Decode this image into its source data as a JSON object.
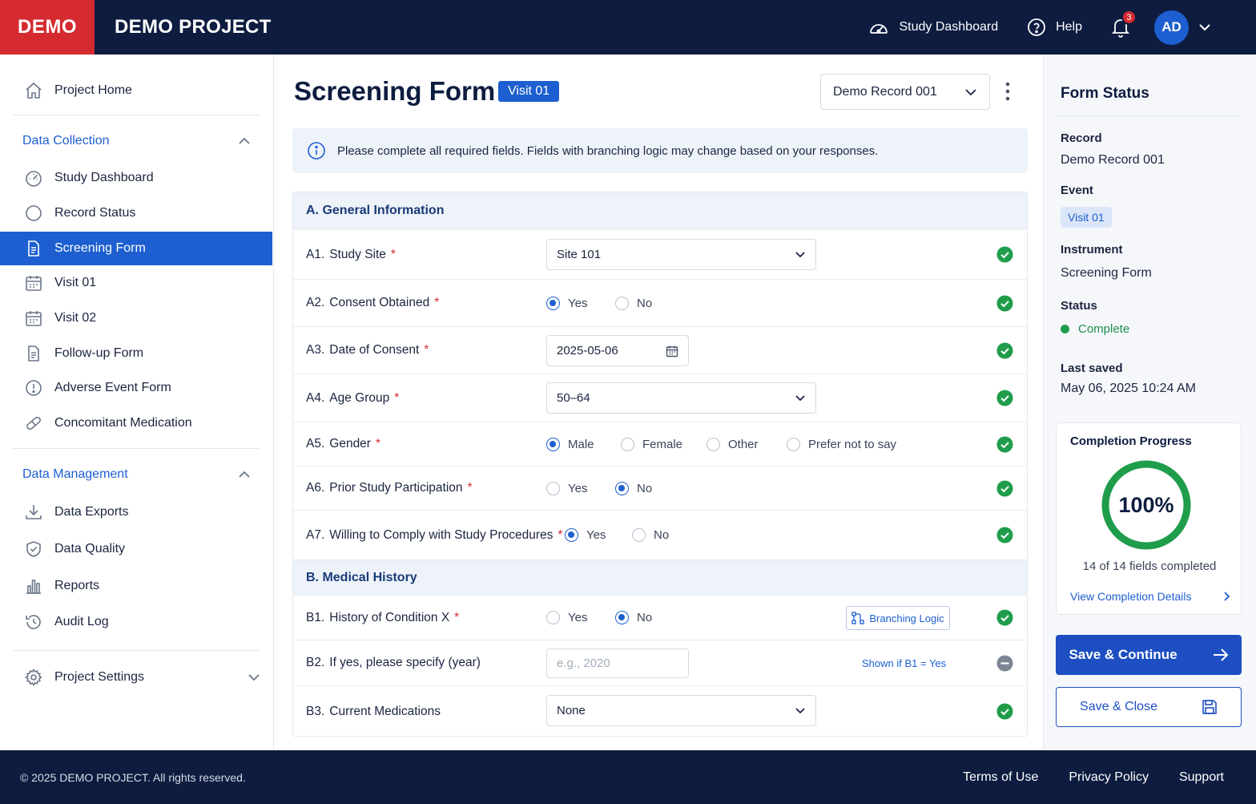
{
  "header": {
    "logo": "DEMO",
    "project_title": "DEMO PROJECT",
    "study_dashboard": "Study Dashboard",
    "help": "Help",
    "notifications_count": "3",
    "avatar_initials": "AD"
  },
  "sidebar": {
    "project_home": "Project Home",
    "data_collection": {
      "title": "Data Collection",
      "items": [
        "Study Dashboard",
        "Record Status",
        "Screening Form",
        "Visit 01",
        "Visit 02",
        "Follow-up Form",
        "Adverse Event Form",
        "Concomitant Medication"
      ]
    },
    "data_management": {
      "title": "Data Management",
      "items": [
        "Data Exports",
        "Data Quality",
        "Reports",
        "Audit Log"
      ]
    },
    "project_settings": "Project Settings"
  },
  "main": {
    "title": "Screening Form",
    "visit_tag": "Visit 01",
    "record_select": "Demo Record 001",
    "info": "Please complete all required fields. Fields with branching logic may change based on your responses.",
    "section_a": "A. General Information",
    "section_b": "B. Medical History",
    "fields": {
      "a1": {
        "num": "A1.",
        "label": "Study Site",
        "value": "Site 101"
      },
      "a2": {
        "num": "A2.",
        "label": "Consent Obtained",
        "opt1": "Yes",
        "opt2": "No"
      },
      "a3": {
        "num": "A3.",
        "label": "Date of Consent",
        "value": "2025-05-06"
      },
      "a4": {
        "num": "A4.",
        "label": "Age Group",
        "value": "50–64"
      },
      "a5": {
        "num": "A5.",
        "label": "Gender",
        "opt1": "Male",
        "opt2": "Female",
        "opt3": "Other",
        "opt4": "Prefer not to say"
      },
      "a6": {
        "num": "A6.",
        "label": "Prior Study Participation",
        "opt1": "Yes",
        "opt2": "No"
      },
      "a7": {
        "num": "A7.",
        "label": "Willing to Comply with Study Procedures",
        "opt1": "Yes",
        "opt2": "No"
      },
      "b1": {
        "num": "B1.",
        "label": "History of Condition X",
        "opt1": "Yes",
        "opt2": "No",
        "branching": "Branching Logic"
      },
      "b2": {
        "num": "B2.",
        "label": "If yes, please specify (year)",
        "placeholder": "e.g., 2020",
        "shown_if": "Shown if B1 = Yes"
      },
      "b3": {
        "num": "B3.",
        "label": "Current Medications",
        "value": "None"
      }
    },
    "required_mark": "*"
  },
  "status_panel": {
    "title": "Form Status",
    "record_label": "Record",
    "record_value": "Demo Record 001",
    "event_label": "Event",
    "event_value": "Visit 01",
    "instrument_label": "Instrument",
    "instrument_value": "Screening Form",
    "status_label": "Status",
    "status_value": "Complete",
    "last_saved_label": "Last saved",
    "last_saved_value": "May 06, 2025 10:24 AM",
    "progress_title": "Completion Progress",
    "progress_pct": "100%",
    "progress_fraction": 1.0,
    "progress_sub": "14 of 14 fields completed",
    "progress_link": "View Completion Details",
    "save_continue": "Save & Continue",
    "save_close": "Save & Close"
  },
  "footer": {
    "copyright": "© 2025 DEMO PROJECT. All rights reserved.",
    "terms": "Terms of Use",
    "privacy": "Privacy Policy",
    "support": "Support"
  },
  "colors": {
    "navy": "#0d1c3f",
    "brand_red": "#d52a30",
    "accent_blue": "#1d5fd0",
    "success_green": "#1f9d4b"
  }
}
